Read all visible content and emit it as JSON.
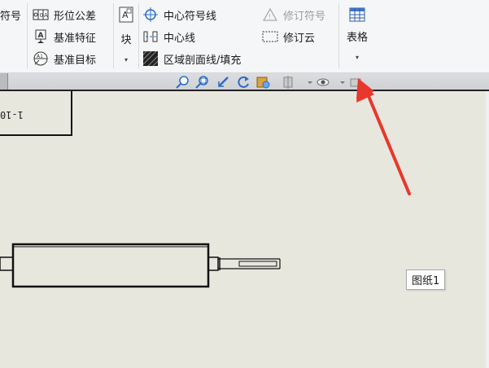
{
  "ribbon": {
    "partial_label": "符号",
    "col1": {
      "item1": "形位公差",
      "item2": "基准特征",
      "item3": "基准目标"
    },
    "block": {
      "label": "块",
      "dropdown": "▾"
    },
    "col3": {
      "item1": "中心符号线",
      "item2": "中心线",
      "item3": "区域剖面线/填充"
    },
    "col4": {
      "item1": "修订符号",
      "item2": "修订云"
    },
    "table": {
      "label": "表格",
      "dropdown": "▾"
    }
  },
  "drawing": {
    "title_block_text": "1-10",
    "sheet_tab": "图纸1"
  },
  "annotation": {
    "arrow_color": "#e8372c"
  }
}
